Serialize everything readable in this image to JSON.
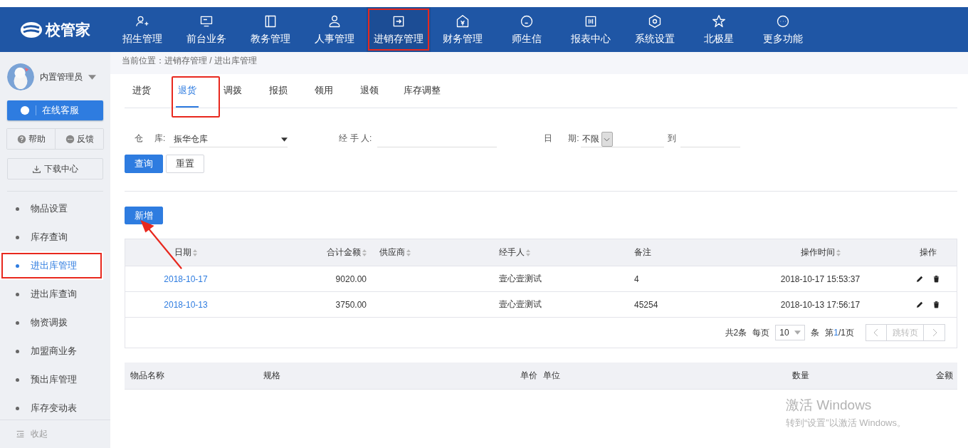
{
  "app": {
    "logo_text": "校管家"
  },
  "nav": [
    {
      "label": "招生管理",
      "selected": false,
      "highlighted": false
    },
    {
      "label": "前台业务",
      "selected": false,
      "highlighted": false
    },
    {
      "label": "教务管理",
      "selected": false,
      "highlighted": false
    },
    {
      "label": "人事管理",
      "selected": false,
      "highlighted": false
    },
    {
      "label": "进销存管理",
      "selected": true,
      "highlighted": true
    },
    {
      "label": "财务管理",
      "selected": false,
      "highlighted": false
    },
    {
      "label": "师生信",
      "selected": false,
      "highlighted": false
    },
    {
      "label": "报表中心",
      "selected": false,
      "highlighted": false
    },
    {
      "label": "系统设置",
      "selected": false,
      "highlighted": false
    },
    {
      "label": "北极星",
      "selected": false,
      "highlighted": false
    },
    {
      "label": "更多功能",
      "selected": false,
      "highlighted": false
    }
  ],
  "sidebar": {
    "user": "内置管理员",
    "service_button": "在线客服",
    "help": "帮助",
    "feedback": "反馈",
    "download": "下载中心",
    "items": [
      {
        "label": "物品设置",
        "selected": false,
        "highlighted": false
      },
      {
        "label": "库存查询",
        "selected": false,
        "highlighted": false
      },
      {
        "label": "进出库管理",
        "selected": true,
        "highlighted": true
      },
      {
        "label": "进出库查询",
        "selected": false,
        "highlighted": false
      },
      {
        "label": "物资调拨",
        "selected": false,
        "highlighted": false
      },
      {
        "label": "加盟商业务",
        "selected": false,
        "highlighted": false
      },
      {
        "label": "预出库管理",
        "selected": false,
        "highlighted": false
      },
      {
        "label": "库存变动表",
        "selected": false,
        "highlighted": false
      }
    ],
    "collapse": "收起"
  },
  "breadcrumb": "当前位置：进销存管理 / 进出库管理",
  "tabs": [
    {
      "label": "进货",
      "selected": false,
      "highlighted": false
    },
    {
      "label": "退货",
      "selected": true,
      "highlighted": true
    },
    {
      "label": "调拨",
      "selected": false,
      "highlighted": false
    },
    {
      "label": "报损",
      "selected": false,
      "highlighted": false
    },
    {
      "label": "领用",
      "selected": false,
      "highlighted": false
    },
    {
      "label": "退领",
      "selected": false,
      "highlighted": false
    },
    {
      "label": "库存调整",
      "selected": false,
      "highlighted": false
    }
  ],
  "filters": {
    "warehouse_label_1": "仓",
    "warehouse_label_2": "库:",
    "warehouse": "振华仓库",
    "handler_label": "经 手 人:",
    "date_label_1": "日",
    "date_label_2": "期:",
    "date_range": "不限",
    "to": "到"
  },
  "buttons": {
    "search": "查询",
    "reset": "重置",
    "add": "新增"
  },
  "table": {
    "columns": [
      {
        "label": "日期",
        "sortable": true
      },
      {
        "label": "合计金额",
        "sortable": true
      },
      {
        "label": "供应商",
        "sortable": true
      },
      {
        "label": "经手人",
        "sortable": true
      },
      {
        "label": "备注",
        "sortable": false
      },
      {
        "label": "操作时间",
        "sortable": true
      },
      {
        "label": "操作",
        "sortable": false
      }
    ],
    "rows": [
      {
        "date": "2018-10-17",
        "amount": "9020.00",
        "supplier": "",
        "handler": "壹心壹测试",
        "note": "4",
        "time": "2018-10-17 15:53:37"
      },
      {
        "date": "2018-10-13",
        "amount": "3750.00",
        "supplier": "",
        "handler": "壹心壹测试",
        "note": "45254",
        "time": "2018-10-13 17:56:17"
      }
    ]
  },
  "pagination": {
    "total": "共2条",
    "per_page_label": "每页",
    "per_page": "10",
    "unit": "条",
    "page_prefix": "第",
    "page_current": "1",
    "page_suffix": "/1页",
    "jump": "跳转页"
  },
  "detail_table": {
    "columns": [
      "物品名称",
      "规格",
      "单价",
      "单位",
      "数量",
      "金额"
    ]
  },
  "activation": {
    "title": "激活 Windows",
    "hint": "转到“设置”以激活 Windows。"
  }
}
